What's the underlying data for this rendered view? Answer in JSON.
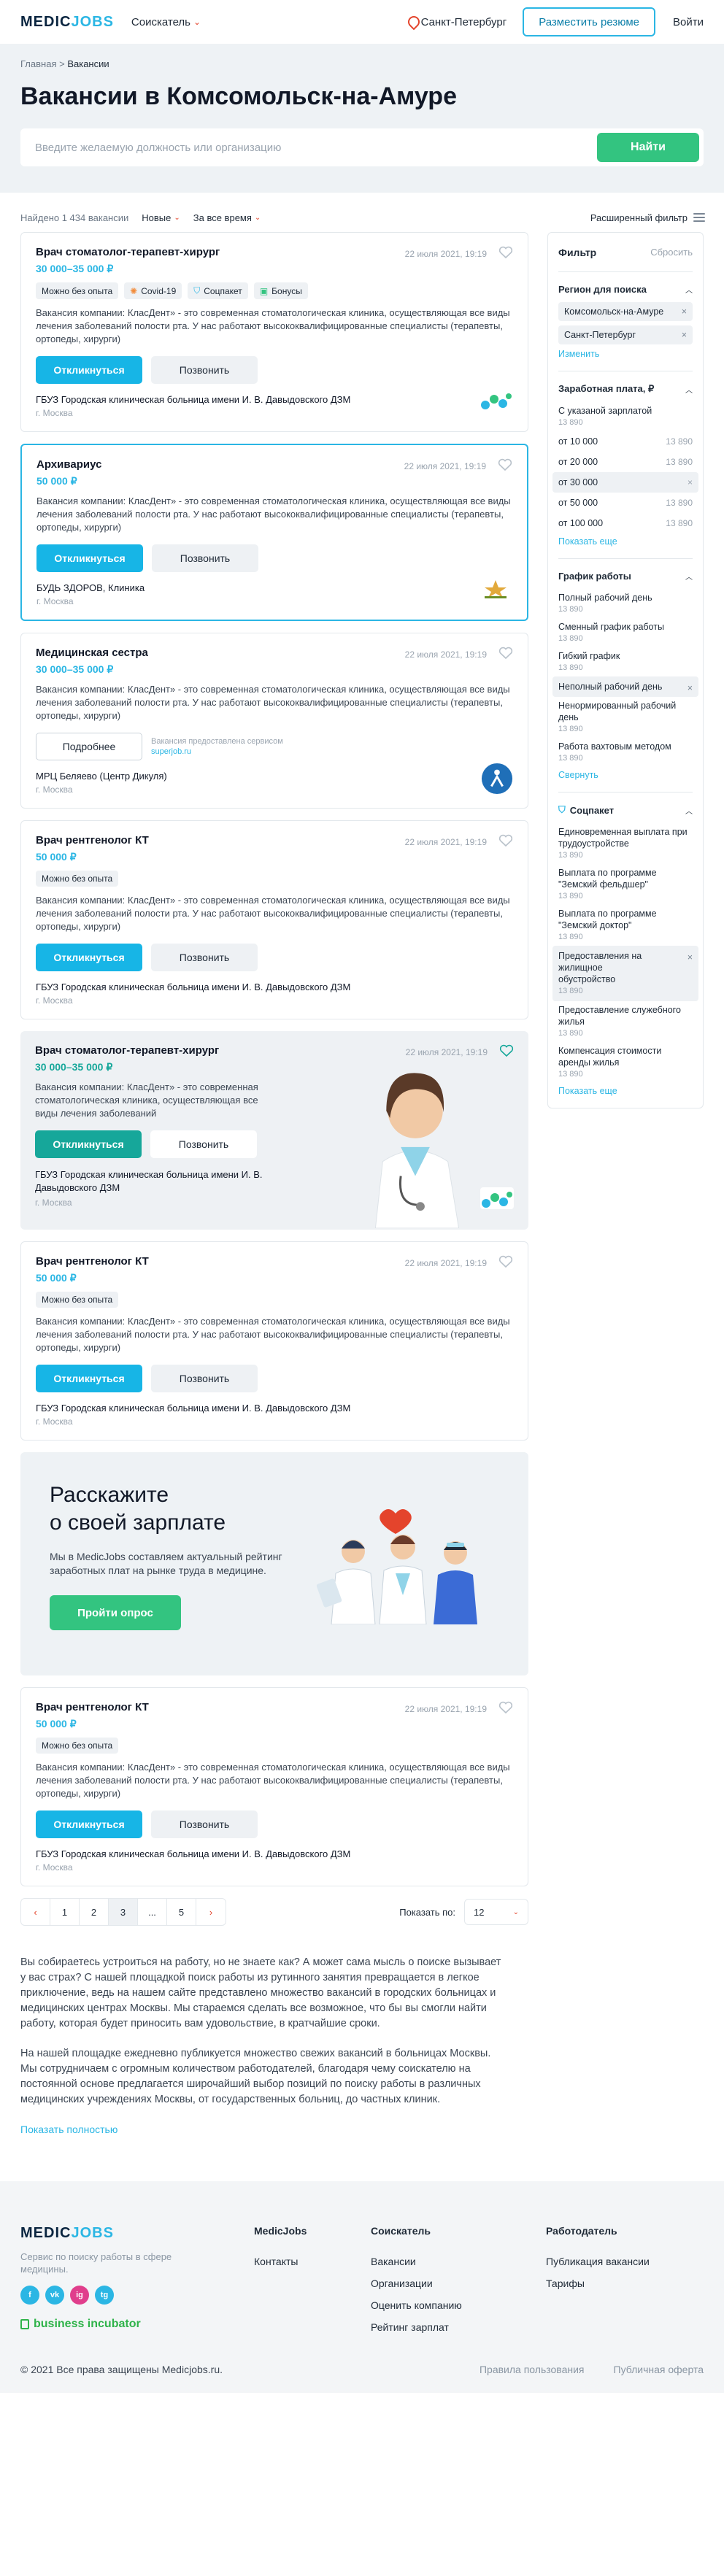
{
  "header": {
    "logo_medic": "MEDIC",
    "logo_jobs": "JOBS",
    "role": "Соискатель",
    "city": "Санкт-Петербург",
    "post_resume": "Разместить резюме",
    "login": "Войти"
  },
  "hero": {
    "crumb_home": "Главная",
    "crumb_sep": ">",
    "crumb_current": "Вакансии",
    "title": "Вакансии в Комсомольск-на-Амуре",
    "search_placeholder": "Введите желаемую должность или организацию",
    "search_button": "Найти"
  },
  "toolbar": {
    "found": "Найдено 1 434 вакансии",
    "sort": "Новые",
    "period": "За все время",
    "advanced": "Расширенный фильтр"
  },
  "common": {
    "respond": "Откликнуться",
    "call": "Позвонить",
    "more": "Подробнее",
    "desc": "Вакансия компании: КласДент» - это современная стоматологическая клиника, осуществляющая все виды лечения заболеваний полости рта. У нас работают высококвалифицированные специалисты (терапевты, ортопеды, хирурги)",
    "desc_short": "Вакансия компании: КласДент» - это современная стоматологическая клиника, осуществляющая все виды лечения заболеваний",
    "date": "22 июля 2021, 19:19",
    "moscow": "г. Москва",
    "org_hospital": "ГБУЗ Городская клиническая больница имени И. В. Давыдовского ДЗМ",
    "no_exp": "Можно без опыта"
  },
  "cards": {
    "c1": {
      "title": "Врач стоматолог-терапевт-хирург",
      "salary": "30 000–35 000 ₽",
      "tag_covid": "Covid-19",
      "tag_social": "Соцпакет",
      "tag_bonus": "Бонусы"
    },
    "c2": {
      "title": "Архивариус",
      "salary": "50 000 ₽",
      "org": "БУДЬ ЗДОРОВ, Клиника"
    },
    "c3": {
      "title": "Медицинская сестра",
      "salary": "30 000–35 000 ₽",
      "sj_text": "Вакансия предоставлена сервисом",
      "sj_link": "superjob.ru",
      "org": "МРЦ Беляево (Центр Дикуля)"
    },
    "c4": {
      "title": "Врач рентгенолог КТ",
      "salary": "50 000 ₽"
    },
    "c5": {
      "title": "Врач стоматолог-терапевт-хирург",
      "salary": "30 000–35 000 ₽",
      "org": "ГБУЗ Городская клиническая больница имени И. В. Давыдовского ДЗМ"
    },
    "c6": {
      "title": "Врач рентгенолог КТ",
      "salary": "50 000 ₽"
    },
    "c7": {
      "title": "Врач рентгенолог КТ",
      "salary": "50 000 ₽"
    }
  },
  "promo": {
    "title1": "Расскажите",
    "title2": "о своей зарплате",
    "text": "Мы в MedicJobs составляем актуальный рейтинг заработных плат на рынке труда в медицине.",
    "button": "Пройти опрос"
  },
  "pager": {
    "prev": "‹",
    "p1": "1",
    "p2": "2",
    "p3": "3",
    "dots": "...",
    "p5": "5",
    "next": "›",
    "show_label": "Показать по:",
    "show_value": "12"
  },
  "filter": {
    "title": "Фильтр",
    "reset": "Сбросить",
    "region_title": "Регион для поиска",
    "region1": "Комсомольск-на-Амуре",
    "region2": "Санкт-Петербург",
    "change": "Изменить",
    "salary_title": "Заработная плата, ₽",
    "sal_specified": "С указаной зарплатой",
    "count": "13 890",
    "from10": "от 10 000",
    "from20": "от 20 000",
    "from30": "от 30 000",
    "from50": "от 50 000",
    "from100": "от 100 000",
    "show_more": "Показать еще",
    "schedule_title": "График работы",
    "s1": "Полный рабочий день",
    "s2": "Сменный график работы",
    "s3": "Гибкий график",
    "s4": "Неполный рабочий день",
    "s5": "Ненормированный рабочий день",
    "s6": "Работа вахтовым методом",
    "collapse": "Свернуть",
    "social_title": "Соцпакет",
    "so1": "Единовременная выплата при трудоустройстве",
    "so2": "Выплата по программе \"Земский фельдшер\"",
    "so3": "Выплата по программе \"Земский доктор\"",
    "so4": "Предоставления на жилищное обустройство",
    "so5": "Предоставление служебного жилья",
    "so6": "Компенсация стоимости аренды жилья",
    "x": "×"
  },
  "seo": {
    "p1": "Вы собираетесь устроиться на работу, но не знаете как? А может сама мысль о поиске вызывает у вас страх? С нашей площадкой поиск работы из рутинного занятия превращается в легкое приключение, ведь на нашем сайте представлено множество вакансий в городских больницах и медицинских центрах Москвы. Мы стараемся сделать все возможное, что бы вы смогли найти работу, которая будет приносить вам удовольствие, в кратчайшие сроки.",
    "p2": "На нашей площадке ежедневно публикуется множество свежих вакансий в больницах Москвы. Мы сотрудничаем с огромным количеством работодателей, благодаря чему соискателю на постоянной основе предлагается широчайший выбор позиций по поиску работы в различных медицинских учреждениях Москвы, от государственных больниц, до частных клиник.",
    "more": "Показать полностью"
  },
  "footer": {
    "desc": "Сервис по поиску работы в сфере медицины.",
    "vk": "vk",
    "ig": "ig",
    "tg": "tg",
    "incubator": "business incubator",
    "col1_title": "MedicJobs",
    "col1_a": "Контакты",
    "col2_title": "Соискатель",
    "col2_a": "Вакансии",
    "col2_b": "Организации",
    "col2_c": "Оценить компанию",
    "col2_d": "Рейтинг зарплат",
    "col3_title": "Работодатель",
    "col3_a": "Публикация вакансии",
    "col3_b": "Тарифы",
    "copyright": "© 2021 Все права защищены Medicjobs.ru.",
    "rules": "Правила пользования",
    "offer": "Публичная оферта"
  }
}
